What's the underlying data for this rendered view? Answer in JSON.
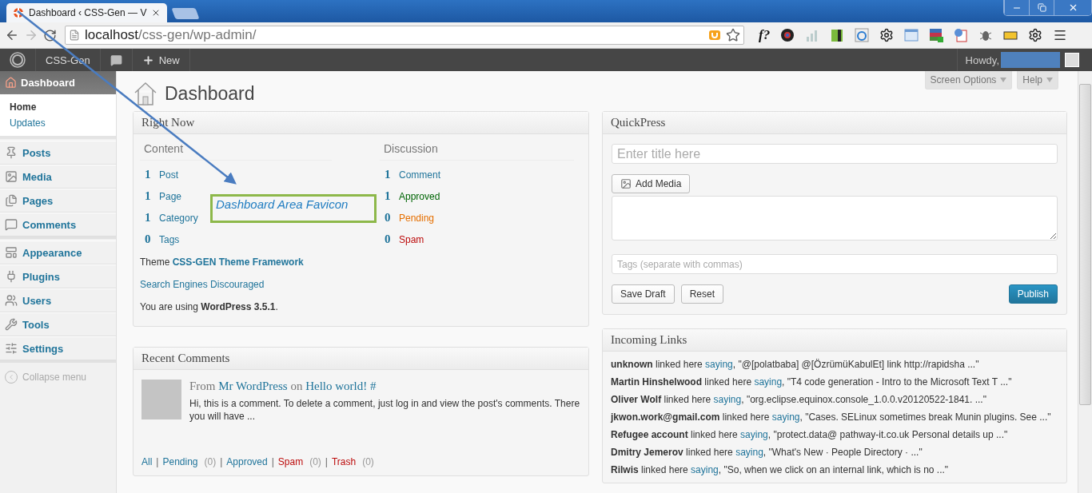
{
  "browser": {
    "tab_title": "Dashboard ‹ CSS-Gen — V",
    "url_host": "localhost",
    "url_path": "/css-gen/wp-admin/",
    "extension_text": "f?"
  },
  "admin_bar": {
    "site": "CSS-Gen",
    "new": "New",
    "howdy": "Howdy,"
  },
  "sidebar": {
    "current": {
      "label": "Dashboard",
      "selected": true,
      "submenu": [
        {
          "label": "Home",
          "selected": true
        },
        {
          "label": "Updates",
          "selected": false
        }
      ]
    },
    "groups": [
      {
        "items": [
          {
            "label": "Posts",
            "selected": false
          },
          {
            "label": "Media",
            "selected": false
          },
          {
            "label": "Pages",
            "selected": false
          },
          {
            "label": "Comments",
            "selected": false
          }
        ]
      },
      {
        "items": [
          {
            "label": "Appearance",
            "selected": false
          },
          {
            "label": "Plugins",
            "selected": false
          },
          {
            "label": "Users",
            "selected": false
          },
          {
            "label": "Tools",
            "selected": false
          },
          {
            "label": "Settings",
            "selected": false
          }
        ]
      }
    ],
    "collapse": "Collapse menu"
  },
  "header": {
    "title": "Dashboard",
    "tabs": [
      "Screen Options",
      "Help"
    ]
  },
  "right_now": {
    "title": "Right Now",
    "content": {
      "heading": "Content",
      "rows": [
        {
          "count": "1",
          "label": "Post"
        },
        {
          "count": "1",
          "label": "Page"
        },
        {
          "count": "1",
          "label": "Category"
        },
        {
          "count": "0",
          "label": "Tags"
        }
      ]
    },
    "discussion": {
      "heading": "Discussion",
      "rows": [
        {
          "count": "1",
          "label": "Comment",
          "color": "#21759b"
        },
        {
          "count": "1",
          "label": "Approved",
          "color": "#006505"
        },
        {
          "count": "0",
          "label": "Pending",
          "color": "#e66f00"
        },
        {
          "count": "0",
          "label": "Spam",
          "color": "#bc0b0b"
        }
      ]
    },
    "theme_prefix": "Theme",
    "theme_name": "CSS-GEN Theme Framework",
    "search_engines": "Search Engines Discouraged",
    "version": "You are using **WordPress 3.5.1**."
  },
  "recent_comments": {
    "title": "Recent Comments",
    "comment": {
      "from": "From",
      "author": "Mr WordPress",
      "on": "on",
      "post": "Hello world!",
      "hash": "#",
      "text": "Hi, this is a comment. To delete a comment, just log in and view the post's comments. There you will have ..."
    },
    "separator": "|",
    "filters": [
      {
        "label": "All",
        "color": "#21759b"
      },
      {
        "label": "Pending",
        "count": "(0)",
        "color": "#21759b"
      },
      {
        "label": "Approved",
        "color": "#21759b"
      },
      {
        "label": "Spam",
        "count": "(0)",
        "color": "#bc0b0b"
      },
      {
        "label": "Trash",
        "count": "(0)",
        "color": "#bc0b0b"
      }
    ]
  },
  "quickpress": {
    "title": "QuickPress",
    "title_placeholder": "Enter title here",
    "add_media": "Add Media",
    "tags_placeholder": "Tags (separate with commas)",
    "save_draft": "Save Draft",
    "reset": "Reset",
    "publish": "Publish"
  },
  "incoming_links": {
    "title": "Incoming Links",
    "items": [
      {
        "author": "unknown",
        "verb": "linked here",
        "link": "saying",
        "rest": ", \"@[polatbaba] @[ÖzrümüKabulEt] link http://rapidsha ...\""
      },
      {
        "author": "Martin Hinshelwood",
        "verb": "linked here",
        "link": "saying",
        "rest": ", \"T4 code generation - Intro to the Microsoft Text T ...\""
      },
      {
        "author": "Oliver Wolf",
        "verb": "linked here",
        "link": "saying",
        "rest": ", \"org.eclipse.equinox.console_1.0.0.v20120522-1841. ...\""
      },
      {
        "author": "jkwon.work@gmail.com",
        "verb": "linked here",
        "link": "saying",
        "rest": ", \"Cases. SELinux sometimes break Munin plugins. See ...\""
      },
      {
        "author": "Refugee account",
        "verb": "linked here",
        "link": "saying",
        "rest": ", \"protect.data@ pathway-it.co.uk Personal details up ...\""
      },
      {
        "author": "Dmitry Jemerov",
        "verb": "linked here",
        "link": "saying",
        "rest": ", \"What's New · People Directory · ...\""
      },
      {
        "author": "Rilwis",
        "verb": "linked here",
        "link": "saying",
        "rest": ", \"So, when we click on an internal link, which is no ...\""
      }
    ]
  },
  "annotation": {
    "label": "Dashboard Area Favicon"
  }
}
